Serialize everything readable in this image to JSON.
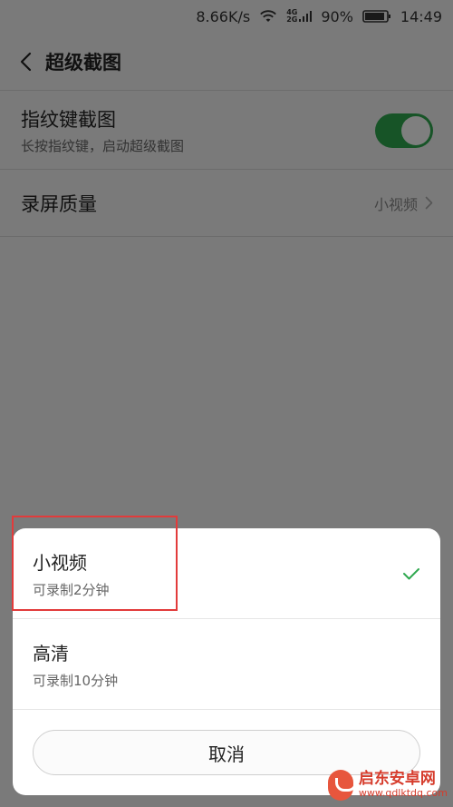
{
  "status_bar": {
    "network_speed": "8.66K/s",
    "network_type_top": "4G",
    "network_type_bottom": "2G",
    "battery_percent": "90%",
    "time": "14:49"
  },
  "title_bar": {
    "title": "超级截图"
  },
  "settings": {
    "fingerprint": {
      "title": "指纹键截图",
      "subtitle": "长按指纹键，启动超级截图",
      "enabled": true
    },
    "record_quality": {
      "title": "录屏质量",
      "value": "小视频"
    }
  },
  "dialog": {
    "options": [
      {
        "title": "小视频",
        "subtitle": "可录制2分钟",
        "selected": true
      },
      {
        "title": "高清",
        "subtitle": "可录制10分钟",
        "selected": false
      }
    ],
    "cancel_label": "取消"
  },
  "colors": {
    "accent_green": "#2fa84f",
    "highlight_red": "#e23b3b"
  },
  "watermark": {
    "name": "启东安卓网",
    "url": "www.qdlktdq.com"
  }
}
